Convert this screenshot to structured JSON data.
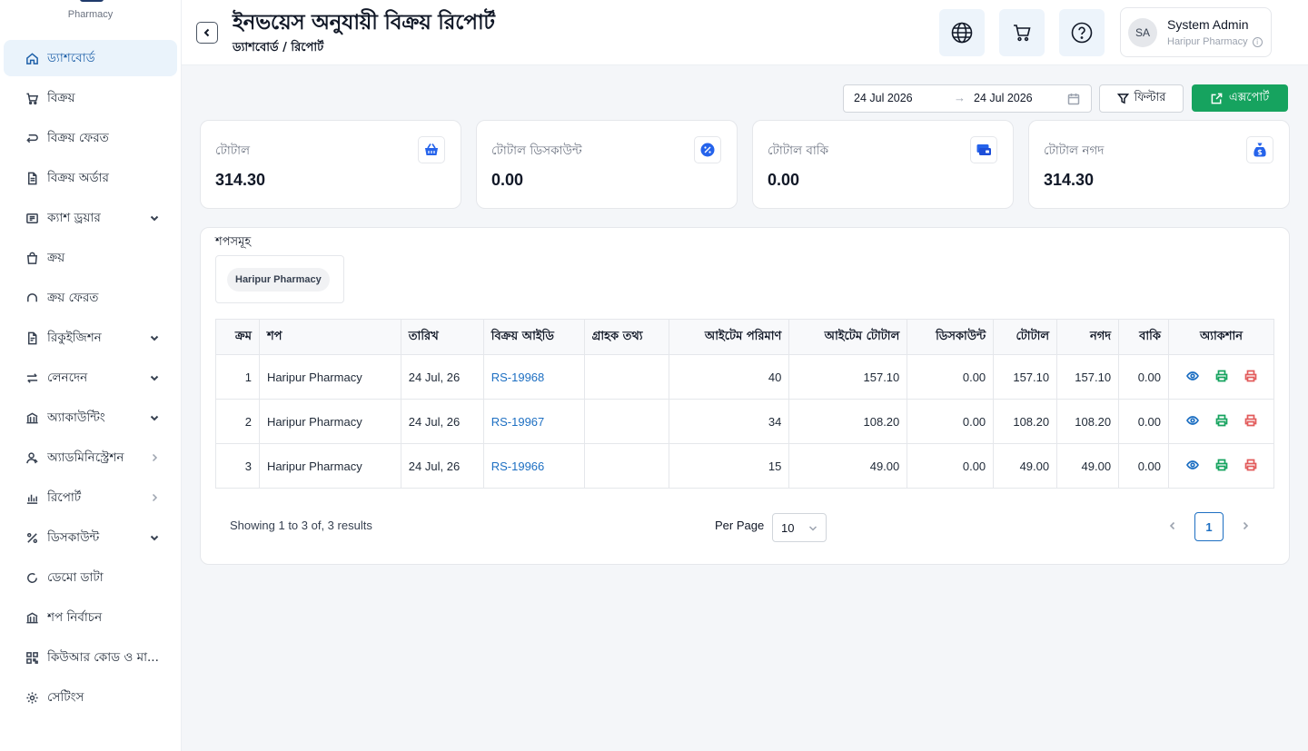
{
  "brand": {
    "subtitle": "Pharmacy"
  },
  "sidebar": {
    "items": [
      {
        "label": "ড্যাশবোর্ড",
        "icon": "home-icon",
        "caret": ""
      },
      {
        "label": "বিক্রয়",
        "icon": "cart-icon",
        "caret": ""
      },
      {
        "label": "বিক্রয় ফেরত",
        "icon": "return-icon",
        "caret": ""
      },
      {
        "label": "বিক্রয় অর্ডার",
        "icon": "document-icon",
        "caret": ""
      },
      {
        "label": "ক্যাশ ড্রয়ার",
        "icon": "drawer-icon",
        "caret": "down"
      },
      {
        "label": "ক্রয়",
        "icon": "bag-icon",
        "caret": ""
      },
      {
        "label": "ক্রয় ফেরত",
        "icon": "refresh-icon",
        "caret": ""
      },
      {
        "label": "রিকুইজিশন",
        "icon": "clipboard-icon",
        "caret": "down"
      },
      {
        "label": "লেনদেন",
        "icon": "exchange-icon",
        "caret": "down"
      },
      {
        "label": "অ্যাকাউন্টিং",
        "icon": "bank-icon",
        "caret": "down"
      },
      {
        "label": "অ্যাডমিনিস্ট্রেশন",
        "icon": "users-icon",
        "caret": "right"
      },
      {
        "label": "রিপোর্ট",
        "icon": "chart-icon",
        "caret": "right"
      },
      {
        "label": "ডিসকাউন্ট",
        "icon": "percent-icon",
        "caret": "down"
      },
      {
        "label": "ডেমো ডাটা",
        "icon": "loader-icon",
        "caret": ""
      },
      {
        "label": "শপ নির্বাচন",
        "icon": "shop-icon",
        "caret": ""
      },
      {
        "label": "কিউআর কোড ও মা...",
        "icon": "qrcode-icon",
        "caret": ""
      },
      {
        "label": "সেটিংস",
        "icon": "gear-icon",
        "caret": ""
      }
    ]
  },
  "header": {
    "title": "ইনভয়েস অনুযায়ী বিক্রয় রিপোর্ট",
    "breadcrumb": "ড্যাশবোর্ড / রিপোর্ট",
    "user": {
      "initials": "SA",
      "name": "System Admin",
      "shop": "Haripur Pharmacy"
    }
  },
  "toolbar": {
    "date_from": "24 Jul 2026",
    "date_to": "24 Jul 2026",
    "filter_label": "ফিল্টার",
    "export_label": "এক্সপোর্ট"
  },
  "cards": [
    {
      "label": "টোটাল",
      "value": "314.30",
      "icon": "basket-icon"
    },
    {
      "label": "টোটাল ডিসকাউন্ট",
      "value": "0.00",
      "icon": "discount-badge-icon"
    },
    {
      "label": "টোটাল বাকি",
      "value": "0.00",
      "icon": "wallet-icon"
    },
    {
      "label": "টোটাল নগদ",
      "value": "314.30",
      "icon": "money-bag-icon"
    }
  ],
  "shops": {
    "label": "শপসমূহ",
    "selected": "Haripur Pharmacy"
  },
  "table": {
    "headers": [
      "ক্রম",
      "শপ",
      "তারিখ",
      "বিক্রয় আইডি",
      "গ্রাহক তথ্য",
      "আইটেম পরিমাণ",
      "আইটেম টোটাল",
      "ডিসকাউন্ট",
      "টোটাল",
      "নগদ",
      "বাকি",
      "অ্যাকশান"
    ],
    "rows": [
      {
        "sl": "1",
        "shop": "Haripur Pharmacy",
        "date": "24 Jul, 26",
        "sale_id": "RS-19968",
        "customer": "",
        "qty": "40",
        "item_total": "157.10",
        "discount": "0.00",
        "total": "157.10",
        "cash": "157.10",
        "due": "0.00"
      },
      {
        "sl": "2",
        "shop": "Haripur Pharmacy",
        "date": "24 Jul, 26",
        "sale_id": "RS-19967",
        "customer": "",
        "qty": "34",
        "item_total": "108.20",
        "discount": "0.00",
        "total": "108.20",
        "cash": "108.20",
        "due": "0.00"
      },
      {
        "sl": "3",
        "shop": "Haripur Pharmacy",
        "date": "24 Jul, 26",
        "sale_id": "RS-19966",
        "customer": "",
        "qty": "15",
        "item_total": "49.00",
        "discount": "0.00",
        "total": "49.00",
        "cash": "49.00",
        "due": "0.00"
      }
    ]
  },
  "pagination": {
    "showing_text": "Showing 1 to 3 of, 3 results",
    "per_page_label": "Per Page",
    "per_page_value": "10",
    "current_page": "1"
  },
  "colors": {
    "primary": "#1d6fc2",
    "success": "#16a35f",
    "danger": "#e25b5b",
    "active_bg": "#eaf3fb"
  }
}
